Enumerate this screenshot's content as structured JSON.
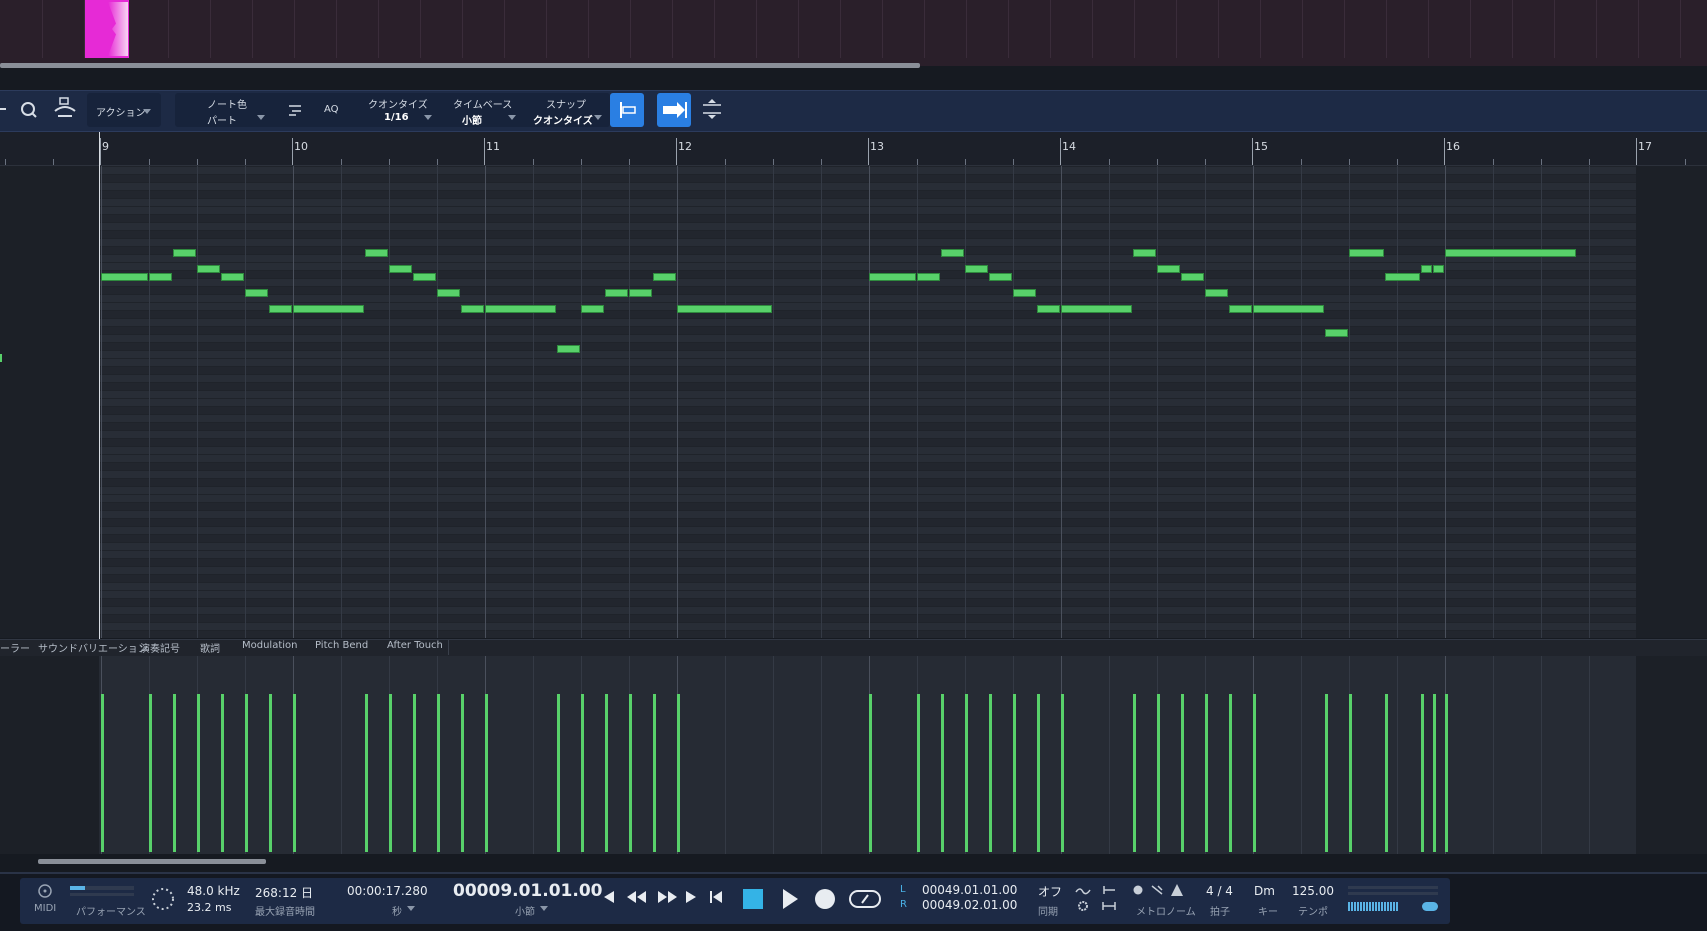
{
  "toolbar": {
    "action_label": "アクション",
    "note_color_label": "ノート色",
    "note_color_value": "パート",
    "aq_label": "AQ",
    "quantize_label": "クオンタイズ",
    "quantize_value": "1/16",
    "timebase_label": "タイムベース",
    "timebase_value": "小節",
    "snap_label": "スナップ",
    "snap_value": "クオンタイズ"
  },
  "ruler": {
    "bars": [
      "9",
      "10",
      "11",
      "12",
      "13",
      "14",
      "15",
      "16",
      "17"
    ]
  },
  "lane_tabs": [
    "ーラー",
    "サウンドバリエーション",
    "演奏記号",
    "歌詞",
    "Modulation",
    "Pitch Bend",
    "After Touch"
  ],
  "transport": {
    "midi_label": "MIDI",
    "performance_label": "パフォーマンス",
    "sample_rate": "48.0 kHz",
    "latency": "23.2 ms",
    "record_time": "268:12 日",
    "record_time_label": "最大録音時間",
    "time_seconds": "00:00:17.280",
    "time_seconds_unit": "秒",
    "position": "00009.01.01.00",
    "position_unit": "小節",
    "loop_left_marker": "L",
    "loop_right_marker": "R",
    "loop_left": "00049.01.01.00",
    "loop_right": "00049.02.01.00",
    "sync_value": "オフ",
    "sync_label": "同期",
    "metronome_label": "メトロノーム",
    "time_signature": "4 / 4",
    "time_signature_label": "拍子",
    "key": "Dm",
    "key_label": "キー",
    "tempo": "125.00",
    "tempo_label": "テンポ"
  },
  "colors": {
    "note": "#58d16a",
    "clip": "#e62ad6",
    "accent": "#2a7fe3"
  }
}
